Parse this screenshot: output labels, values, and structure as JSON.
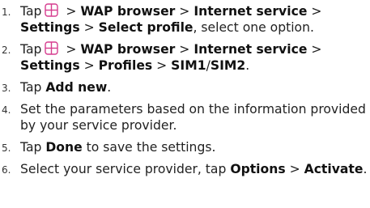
{
  "steps": [
    {
      "num": "1.",
      "a": "Tap",
      "sep1": " > ",
      "b1": "WAP browser",
      "sep2": " > ",
      "b2": "Internet service",
      "sep3": " > ",
      "b3": "Settings",
      "sep4": " > ",
      "b4": "Select profile",
      "tail": ", select one option."
    },
    {
      "num": "2.",
      "a": "Tap",
      "sep1": " > ",
      "b1": "WAP browser",
      "sep2": " > ",
      "b2": "Internet service",
      "sep3": " > ",
      "b3": "Settings",
      "sep4": " > ",
      "b4": "Profiles",
      "sep5": " > ",
      "b5": "SIM1",
      "slash": "/",
      "b6": "SIM2",
      "tail": "."
    },
    {
      "num": "3.",
      "a": "Tap ",
      "b1": "Add new",
      "tail": "."
    },
    {
      "num": "4.",
      "text": "Set the parameters based on the information provided by your service provider."
    },
    {
      "num": "5.",
      "a": "Tap ",
      "b1": "Done",
      "tail": " to save the settings."
    },
    {
      "num": "6.",
      "a": "Select your service provider, tap ",
      "b1": "Options",
      "sep1": " > ",
      "b2": "Activate",
      "tail": "."
    }
  ],
  "icon": {
    "name": "menu-grid-icon",
    "color": "#d63d8f"
  }
}
